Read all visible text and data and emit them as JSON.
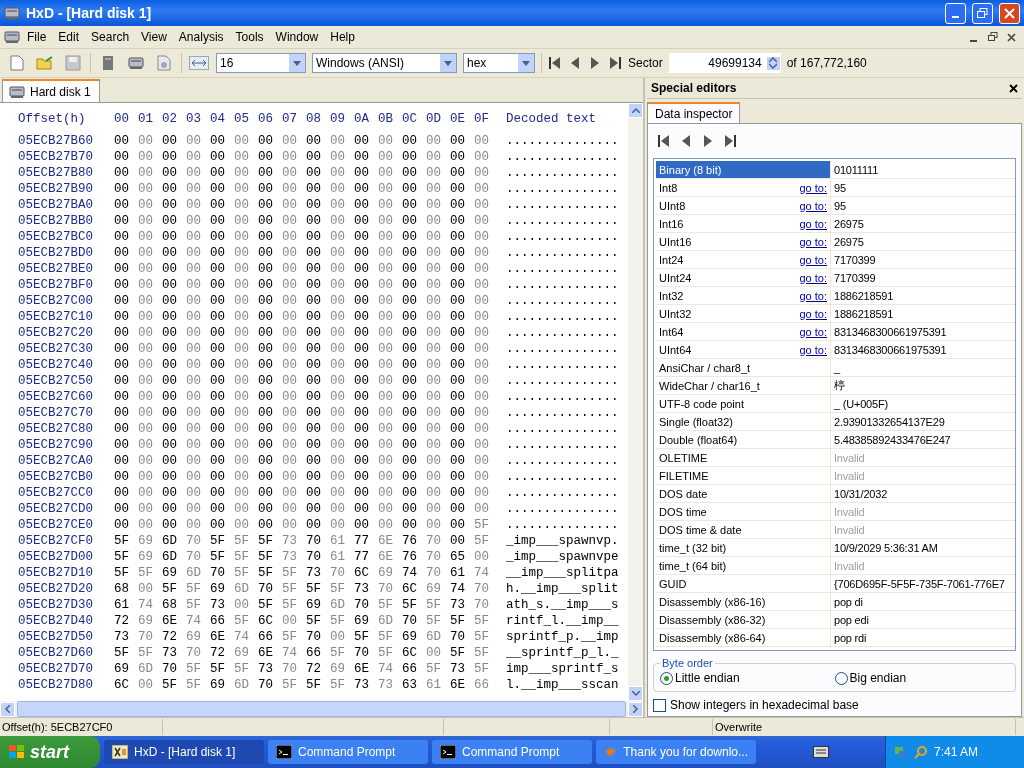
{
  "window": {
    "title": "HxD - [Hard disk 1]"
  },
  "menu": [
    "File",
    "Edit",
    "Search",
    "View",
    "Analysis",
    "Tools",
    "Window",
    "Help"
  ],
  "toolbar": {
    "bytes_per_row": "16",
    "charset": "Windows (ANSI)",
    "number_base": "hex",
    "sector_label": "Sector",
    "sector": "49699134",
    "sector_total": "of 167,772,160"
  },
  "document_tabs": [
    {
      "label": "Hard disk 1",
      "selected": true
    }
  ],
  "hex_view": {
    "header": {
      "offset": "Offset(h)",
      "columns": [
        "00",
        "01",
        "02",
        "03",
        "04",
        "05",
        "06",
        "07",
        "08",
        "09",
        "0A",
        "0B",
        "0C",
        "0D",
        "0E",
        "0F"
      ],
      "decoded": "Decoded text"
    },
    "rows": [
      {
        "offset": "05ECB27B60",
        "bytes": "00 00 00 00 00 00 00 00 00 00 00 00 00 00 00 00",
        "text": "..............."
      },
      {
        "offset": "05ECB27B70",
        "bytes": "00 00 00 00 00 00 00 00 00 00 00 00 00 00 00 00",
        "text": "..............."
      },
      {
        "offset": "05ECB27B80",
        "bytes": "00 00 00 00 00 00 00 00 00 00 00 00 00 00 00 00",
        "text": "..............."
      },
      {
        "offset": "05ECB27B90",
        "bytes": "00 00 00 00 00 00 00 00 00 00 00 00 00 00 00 00",
        "text": "..............."
      },
      {
        "offset": "05ECB27BA0",
        "bytes": "00 00 00 00 00 00 00 00 00 00 00 00 00 00 00 00",
        "text": "..............."
      },
      {
        "offset": "05ECB27BB0",
        "bytes": "00 00 00 00 00 00 00 00 00 00 00 00 00 00 00 00",
        "text": "..............."
      },
      {
        "offset": "05ECB27BC0",
        "bytes": "00 00 00 00 00 00 00 00 00 00 00 00 00 00 00 00",
        "text": "..............."
      },
      {
        "offset": "05ECB27BD0",
        "bytes": "00 00 00 00 00 00 00 00 00 00 00 00 00 00 00 00",
        "text": "..............."
      },
      {
        "offset": "05ECB27BE0",
        "bytes": "00 00 00 00 00 00 00 00 00 00 00 00 00 00 00 00",
        "text": "..............."
      },
      {
        "offset": "05ECB27BF0",
        "bytes": "00 00 00 00 00 00 00 00 00 00 00 00 00 00 00 00",
        "text": "..............."
      },
      {
        "offset": "05ECB27C00",
        "bytes": "00 00 00 00 00 00 00 00 00 00 00 00 00 00 00 00",
        "text": "..............."
      },
      {
        "offset": "05ECB27C10",
        "bytes": "00 00 00 00 00 00 00 00 00 00 00 00 00 00 00 00",
        "text": "..............."
      },
      {
        "offset": "05ECB27C20",
        "bytes": "00 00 00 00 00 00 00 00 00 00 00 00 00 00 00 00",
        "text": "..............."
      },
      {
        "offset": "05ECB27C30",
        "bytes": "00 00 00 00 00 00 00 00 00 00 00 00 00 00 00 00",
        "text": "..............."
      },
      {
        "offset": "05ECB27C40",
        "bytes": "00 00 00 00 00 00 00 00 00 00 00 00 00 00 00 00",
        "text": "..............."
      },
      {
        "offset": "05ECB27C50",
        "bytes": "00 00 00 00 00 00 00 00 00 00 00 00 00 00 00 00",
        "text": "..............."
      },
      {
        "offset": "05ECB27C60",
        "bytes": "00 00 00 00 00 00 00 00 00 00 00 00 00 00 00 00",
        "text": "..............."
      },
      {
        "offset": "05ECB27C70",
        "bytes": "00 00 00 00 00 00 00 00 00 00 00 00 00 00 00 00",
        "text": "..............."
      },
      {
        "offset": "05ECB27C80",
        "bytes": "00 00 00 00 00 00 00 00 00 00 00 00 00 00 00 00",
        "text": "..............."
      },
      {
        "offset": "05ECB27C90",
        "bytes": "00 00 00 00 00 00 00 00 00 00 00 00 00 00 00 00",
        "text": "..............."
      },
      {
        "offset": "05ECB27CA0",
        "bytes": "00 00 00 00 00 00 00 00 00 00 00 00 00 00 00 00",
        "text": "..............."
      },
      {
        "offset": "05ECB27CB0",
        "bytes": "00 00 00 00 00 00 00 00 00 00 00 00 00 00 00 00",
        "text": "..............."
      },
      {
        "offset": "05ECB27CC0",
        "bytes": "00 00 00 00 00 00 00 00 00 00 00 00 00 00 00 00",
        "text": "..............."
      },
      {
        "offset": "05ECB27CD0",
        "bytes": "00 00 00 00 00 00 00 00 00 00 00 00 00 00 00 00",
        "text": "..............."
      },
      {
        "offset": "05ECB27CE0",
        "bytes": "00 00 00 00 00 00 00 00 00 00 00 00 00 00 00 5F",
        "text": "..............."
      },
      {
        "offset": "05ECB27CF0",
        "bytes": "5F 69 6D 70 5F 5F 5F 73 70 61 77 6E 76 70 00 5F",
        "text": "_imp___spawnvp."
      },
      {
        "offset": "05ECB27D00",
        "bytes": "5F 69 6D 70 5F 5F 5F 73 70 61 77 6E 76 70 65 00",
        "text": "_imp___spawnvpe"
      },
      {
        "offset": "05ECB27D10",
        "bytes": "5F 5F 69 6D 70 5F 5F 5F 73 70 6C 69 74 70 61 74",
        "text": "__imp___splitpa"
      },
      {
        "offset": "05ECB27D20",
        "bytes": "68 00 5F 5F 69 6D 70 5F 5F 5F 73 70 6C 69 74 70",
        "text": "h.__imp___split"
      },
      {
        "offset": "05ECB27D30",
        "bytes": "61 74 68 5F 73 00 5F 5F 69 6D 70 5F 5F 5F 73 70",
        "text": "ath_s.__imp___s"
      },
      {
        "offset": "05ECB27D40",
        "bytes": "72 69 6E 74 66 5F 6C 00 5F 5F 69 6D 70 5F 5F 5F",
        "text": "rintf_l.__imp__"
      },
      {
        "offset": "05ECB27D50",
        "bytes": "73 70 72 69 6E 74 66 5F 70 00 5F 5F 69 6D 70 5F",
        "text": "sprintf_p.__imp"
      },
      {
        "offset": "05ECB27D60",
        "bytes": "5F 5F 73 70 72 69 6E 74 66 5F 70 5F 6C 00 5F 5F",
        "text": "__sprintf_p_l._"
      },
      {
        "offset": "05ECB27D70",
        "bytes": "69 6D 70 5F 5F 5F 73 70 72 69 6E 74 66 5F 73 5F",
        "text": "imp___sprintf_s"
      },
      {
        "offset": "05ECB27D80",
        "bytes": "6C 00 5F 5F 69 6D 70 5F 5F 5F 73 73 63 61 6E 66",
        "text": "l.__imp___sscan"
      }
    ]
  },
  "special_editors": {
    "title": "Special editors",
    "tabs": [
      {
        "label": "Data inspector",
        "selected": true
      }
    ],
    "rows": [
      {
        "label": "Binary (8 bit)",
        "value": "01011111",
        "selected": true,
        "disabled": false
      },
      {
        "label": "Int8",
        "goto": "go to:",
        "value": "95",
        "selected": false,
        "disabled": false
      },
      {
        "label": "UInt8",
        "goto": "go to:",
        "value": "95",
        "selected": false,
        "disabled": false
      },
      {
        "label": "Int16",
        "goto": "go to:",
        "value": "26975",
        "selected": false,
        "disabled": false
      },
      {
        "label": "UInt16",
        "goto": "go to:",
        "value": "26975",
        "selected": false,
        "disabled": false
      },
      {
        "label": "Int24",
        "goto": "go to:",
        "value": "7170399",
        "selected": false,
        "disabled": false
      },
      {
        "label": "UInt24",
        "goto": "go to:",
        "value": "7170399",
        "selected": false,
        "disabled": false
      },
      {
        "label": "Int32",
        "goto": "go to:",
        "value": "1886218591",
        "selected": false,
        "disabled": false
      },
      {
        "label": "UInt32",
        "goto": "go to:",
        "value": "1886218591",
        "selected": false,
        "disabled": false
      },
      {
        "label": "Int64",
        "goto": "go to:",
        "value": "8313468300661975391",
        "selected": false,
        "disabled": false
      },
      {
        "label": "UInt64",
        "goto": "go to:",
        "value": "8313468300661975391",
        "selected": false,
        "disabled": false
      },
      {
        "label": "AnsiChar / char8_t",
        "value": "_",
        "selected": false,
        "disabled": false
      },
      {
        "label": "WideChar / char16_t",
        "value": "楟",
        "selected": false,
        "disabled": false
      },
      {
        "label": "UTF-8 code point",
        "value": "_ (U+005F)",
        "selected": false,
        "disabled": false
      },
      {
        "label": "Single (float32)",
        "value": "2.93901332654137E29",
        "selected": false,
        "disabled": false
      },
      {
        "label": "Double (float64)",
        "value": "5.48385892433476E247",
        "selected": false,
        "disabled": false
      },
      {
        "label": "OLETIME",
        "value": "Invalid",
        "selected": false,
        "disabled": true
      },
      {
        "label": "FILETIME",
        "value": "Invalid",
        "selected": false,
        "disabled": true
      },
      {
        "label": "DOS date",
        "value": "10/31/2032",
        "selected": false,
        "disabled": false
      },
      {
        "label": "DOS time",
        "value": "Invalid",
        "selected": false,
        "disabled": true
      },
      {
        "label": "DOS time & date",
        "value": "Invalid",
        "selected": false,
        "disabled": true
      },
      {
        "label": "time_t (32 bit)",
        "value": "10/9/2029 5:36:31 AM",
        "selected": false,
        "disabled": false
      },
      {
        "label": "time_t (64 bit)",
        "value": "Invalid",
        "selected": false,
        "disabled": true
      },
      {
        "label": "GUID",
        "value": "{706D695F-5F5F-735F-7061-776E7",
        "selected": false,
        "disabled": false
      },
      {
        "label": "Disassembly (x86-16)",
        "value": "pop di",
        "selected": false,
        "disabled": false
      },
      {
        "label": "Disassembly (x86-32)",
        "value": "pop edi",
        "selected": false,
        "disabled": false
      },
      {
        "label": "Disassembly (x86-64)",
        "value": "pop rdi",
        "selected": false,
        "disabled": false
      }
    ],
    "byte_order": {
      "title": "Byte order",
      "options": [
        {
          "label": "Little endian",
          "selected": true
        },
        {
          "label": "Big endian",
          "selected": false
        }
      ]
    },
    "hex_integers": {
      "label": "Show integers in hexadecimal base",
      "checked": false
    }
  },
  "status_bar": {
    "offset": "Offset(h): 5ECB27CF0",
    "mode": "Overwrite"
  },
  "taskbar": {
    "start": "start",
    "items": [
      {
        "label": "HxD - [Hard disk 1]",
        "kind": "app",
        "selected": true
      },
      {
        "label": "Command Prompt",
        "kind": "console",
        "selected": false
      },
      {
        "label": "Command Prompt",
        "kind": "console",
        "selected": false
      },
      {
        "label": "Thank you for downlo...",
        "kind": "browser",
        "selected": false
      }
    ],
    "clock": "7:41 AM"
  }
}
